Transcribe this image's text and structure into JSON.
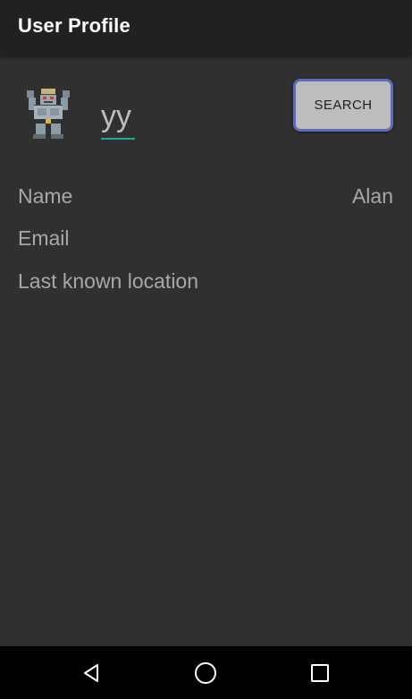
{
  "app_bar": {
    "title": "User Profile"
  },
  "search": {
    "input_value": "yy",
    "button_label": "SEARCH"
  },
  "avatar": {
    "icon": "pokemon-machoke-sprite"
  },
  "profile": {
    "name_label": "Name",
    "name_value": "Alan",
    "email_label": "Email",
    "email_value": "",
    "location_label": "Last known location",
    "location_value": ""
  },
  "nav": {
    "back_icon": "back-triangle-icon",
    "home_icon": "home-circle-icon",
    "recent_icon": "recent-apps-square-icon"
  },
  "colors": {
    "background": "#303030",
    "app_bar": "#212121",
    "input_underline": "#26a69a",
    "button_border": "#5c6bc0",
    "button_fill": "#bdbdbd"
  }
}
